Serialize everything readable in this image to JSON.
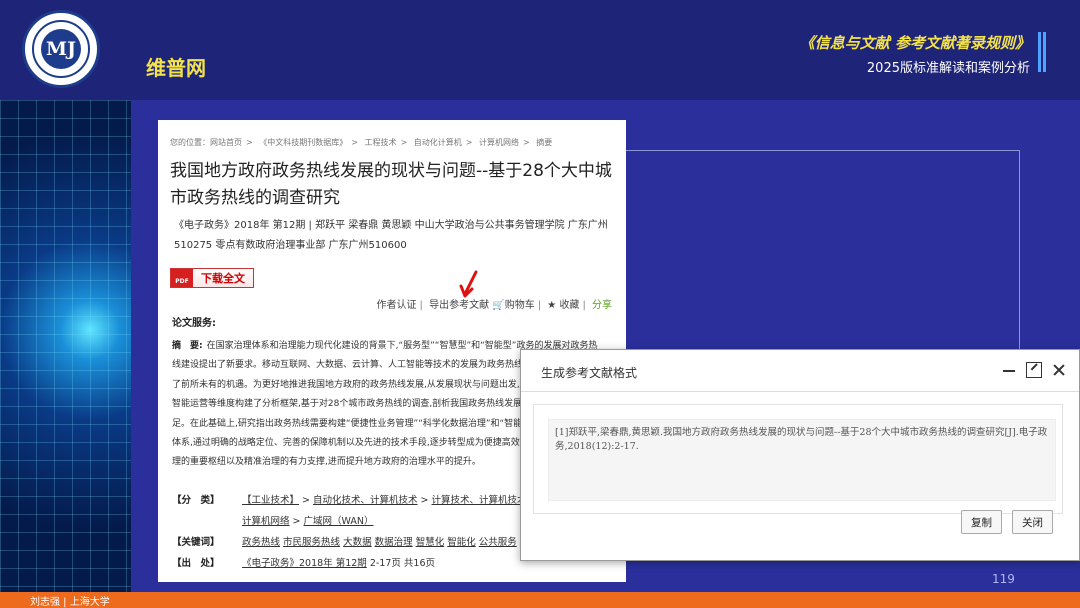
{
  "header": {
    "logo_text": "MJ",
    "site_title": "维普网",
    "deck_title_line1": "《信息与文献  参考文献著录规则》",
    "deck_title_line2": "2025版标准解读和案例分析"
  },
  "web_page": {
    "breadcrumbs": [
      "您的位置：网站首页",
      "《中文科技期刊数据库》",
      "工程技术",
      "自动化计算机",
      "计算机网络",
      "摘要"
    ],
    "title": "我国地方政府政务热线发展的现状与问题--基于28个大中城市政务热线的调查研究",
    "meta_line1": "《电子政务》2018年 第12期 | 郑跃平 梁春鼎 黄思颖   中山大学政治与公共事务管理学院 广东广州",
    "meta_line2": "510275 零点有数政府治理事业部 广东广州510600",
    "download_button": "下载全文",
    "pdf_icon": "PDF",
    "actions": {
      "author_cert": "作者认证",
      "export_ref": "导出参考文献",
      "cart": "购物车",
      "favorite": "收藏",
      "share": "分享"
    },
    "service_title": "论文服务:",
    "abstract_label": "摘　要:",
    "abstract_text": "在国家治理体系和治理能力现代化建设的背景下,“服务型”“智慧型”和“智能型”政务的发展对政务热线建设提出了新要求。移动互联网、大数据、云计算、人工智能等技术的发展为政务热线的创新和发展带来了前所未有的机遇。为更好地推进我国地方政府的政务热线发展,从发展现状与问题出发,从管理、数据治理、智能运营等维度构建了分析框架,基于对28个城市政务热线的调查,剖析我国政务热线发展现状及存在的不足。在此基础上,研究指出政务热线需要构建“便捷性业务管理”“科学化数据治理”和“智能化运营管理”的闭环体系,通过明确的战略定位、完善的保障机制以及先进的技术手段,逐步转型成为便捷高效的服务平台、协同治理的重要枢纽以及精准治理的有力支撑,进而提升地方政府的治理水平的提升。",
    "classification_label": "【分　类】",
    "classification_parts": [
      "【工业技术】",
      "自动化技术、计算机技术",
      "计算技术、计算机技术"
    ],
    "classification_line2": [
      "计算机网络",
      "广域网（WAN）"
    ],
    "keywords_label": "【关键词】",
    "keywords": [
      "政务热线",
      "市民服务热线",
      "大数据",
      "数据治理",
      "智慧化",
      "智能化",
      "公共服务"
    ],
    "source_label": "【出　处】",
    "source_link": "《电子政务》2018年 第12期",
    "source_pages": "2-17页 共16页"
  },
  "modal": {
    "title": "生成参考文献格式",
    "citation": "[1]郑跃平,梁春鼎,黄思颖.我国地方政府政务热线发展的现状与问题--基于28个大中城市政务热线的调查研究[J].电子政务,2018(12):2-17.",
    "copy_button": "复制",
    "close_button": "关闭"
  },
  "page_number": "119",
  "footer_text": "刘志强 | 上海大学",
  "colors": {
    "slide_bg": "#2a2f9c",
    "header_bg": "#1e2478",
    "title_yellow": "#f3e24a",
    "footer_orange": "#ee6a1c",
    "share_green": "#5a9e1c",
    "arrow_red": "#e01010"
  },
  "icons": {
    "arrow": "red-arrow-icon",
    "cart": "cart-icon",
    "star": "star-icon"
  }
}
